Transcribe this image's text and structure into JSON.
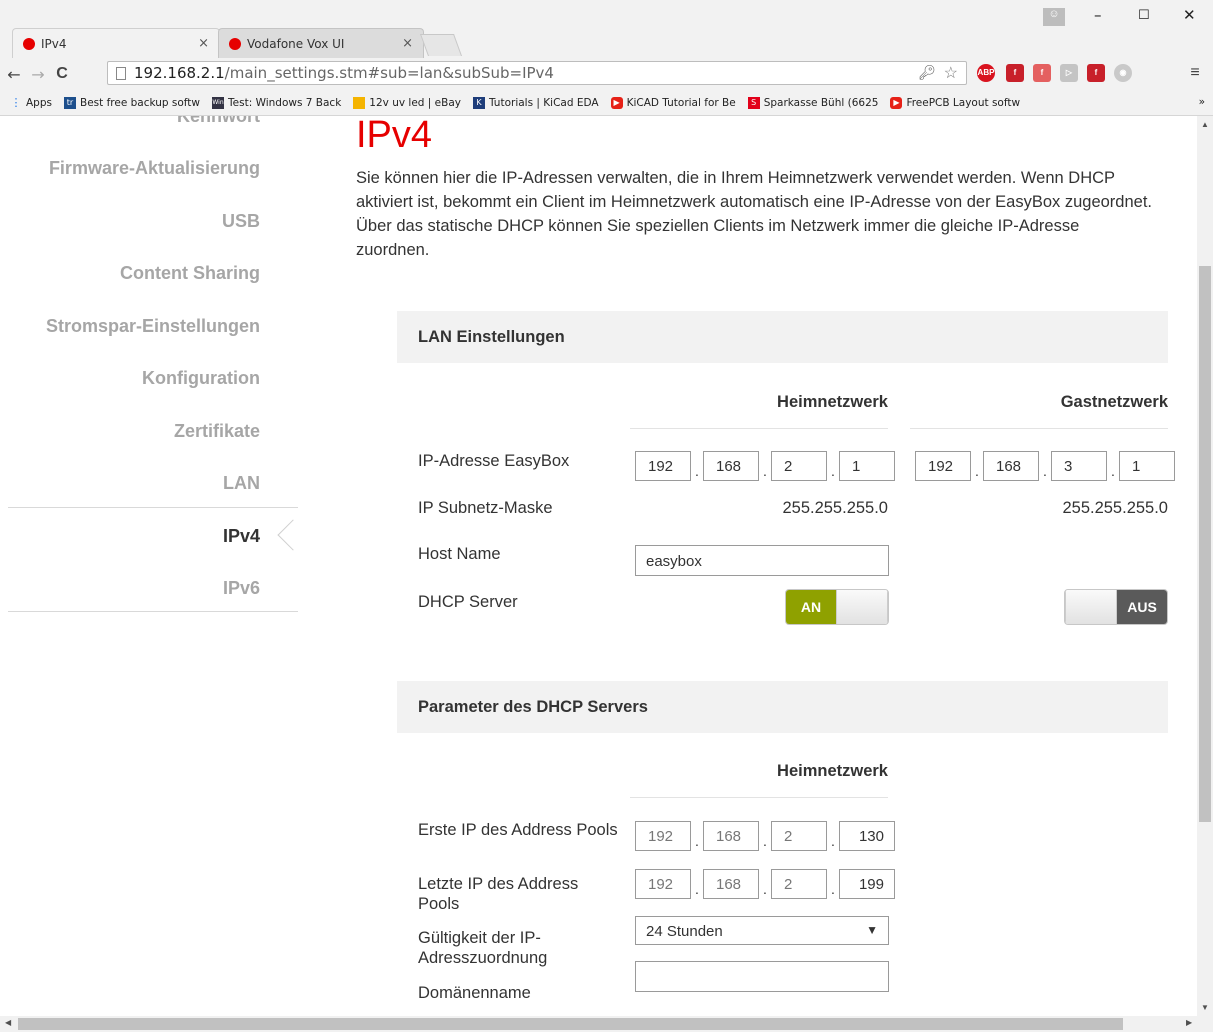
{
  "browser": {
    "tabs": [
      {
        "title": "IPv4",
        "close": "×"
      },
      {
        "title": "Vodafone Vox UI",
        "close": "×"
      }
    ],
    "window_controls": {
      "minimize": "–",
      "maximize": "☐",
      "close": "✕"
    },
    "nav": {
      "back": "←",
      "forward": "→",
      "reload": "C"
    },
    "url_host": "192.168.2.1",
    "url_path": "/main_settings.stm#sub=lan&subSub=IPv4",
    "extensions": [
      "ABP"
    ],
    "menu": "≡",
    "bookmarks": [
      "Apps",
      "Best free backup softw",
      "Test: Windows 7 Back",
      "12v uv led | eBay",
      "Tutorials | KiCad EDA",
      "KiCAD Tutorial for Be",
      "Sparkasse Bühl (6625",
      "FreePCB Layout softw"
    ],
    "bookmarks_more": "»"
  },
  "sidebar": {
    "items": [
      {
        "label": "Kennwort"
      },
      {
        "label": "Firmware-Aktualisierung"
      },
      {
        "label": "USB"
      },
      {
        "label": "Content Sharing"
      },
      {
        "label": "Stromspar-Einstellungen"
      },
      {
        "label": "Konfiguration"
      },
      {
        "label": "Zertifikate"
      },
      {
        "label": "LAN"
      },
      {
        "label": "IPv4"
      },
      {
        "label": "IPv6"
      }
    ],
    "selected": "IPv4"
  },
  "page": {
    "title": "IPv4",
    "intro": "Sie können hier die IP-Adressen verwalten, die in Ihrem Heimnetzwerk verwendet werden. Wenn DHCP aktiviert ist, bekommt ein Client im Heimnetzwerk automatisch eine IP-Adresse von der EasyBox zugeordnet. Über das statische DHCP können Sie speziellen Clients im Netzwerk immer die gleiche IP-Adresse zuordnen."
  },
  "lan": {
    "heading": "LAN Einstellungen",
    "col_home": "Heimnetzwerk",
    "col_guest": "Gastnetzwerk",
    "ip_label": "IP-Adresse EasyBox",
    "home_ip": [
      "192",
      "168",
      "2",
      "1"
    ],
    "guest_ip": [
      "192",
      "168",
      "3",
      "1"
    ],
    "mask_label": "IP Subnetz-Maske",
    "home_mask": "255.255.255.0",
    "guest_mask": "255.255.255.0",
    "host_label": "Host Name",
    "host_value": "easybox",
    "dhcp_label": "DHCP Server",
    "home_dhcp": "AN",
    "guest_dhcp": "AUS"
  },
  "dhcp": {
    "heading": "Parameter des DHCP Servers",
    "col_home": "Heimnetzwerk",
    "first_label": "Erste IP des Address Pools",
    "first_ip": [
      "192",
      "168",
      "2",
      "130"
    ],
    "last_label": "Letzte IP des Address Pools",
    "last_ip": [
      "192",
      "168",
      "2",
      "199"
    ],
    "lease_label": "Gültigkeit der IP-Adresszuordnung",
    "lease_value": "24 Stunden",
    "domain_label": "Domänenname",
    "domain_value": ""
  },
  "colors": {
    "brand": "#e60000",
    "toggle_on": "#8fa100",
    "toggle_off": "#5a5a5a"
  }
}
